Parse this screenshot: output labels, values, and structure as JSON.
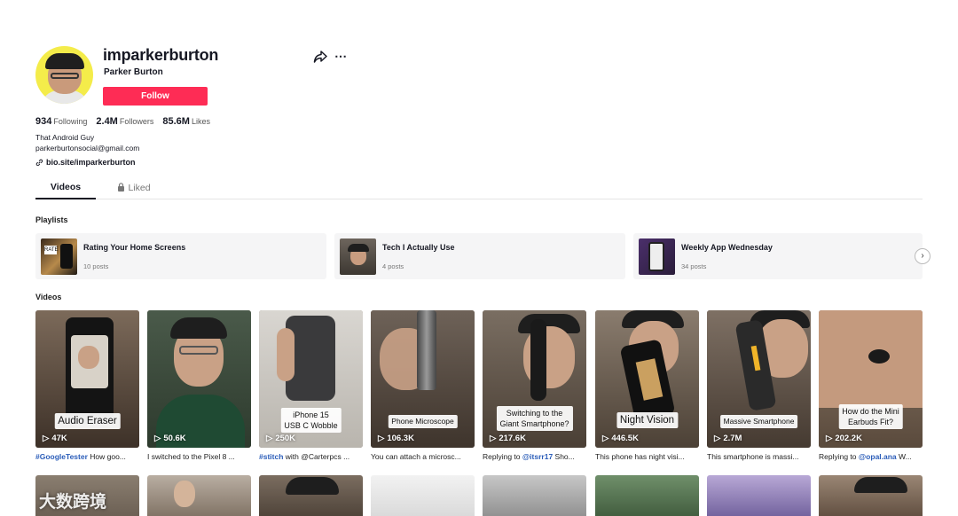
{
  "profile": {
    "username": "imparkerburton",
    "nickname": "Parker Burton",
    "follow_label": "Follow",
    "stats": [
      {
        "value": "934",
        "label": "Following"
      },
      {
        "value": "2.4M",
        "label": "Followers"
      },
      {
        "value": "85.6M",
        "label": "Likes"
      }
    ],
    "bio_line1": "That Android Guy",
    "bio_line2": "parkerburtonsocial@gmail.com",
    "link": "bio.site/imparkerburton"
  },
  "tabs": {
    "videos": "Videos",
    "liked": "Liked"
  },
  "sections": {
    "playlists": "Playlists",
    "videos": "Videos"
  },
  "playlists": [
    {
      "title": "Rating Your Home Screens",
      "count": "10 posts"
    },
    {
      "title": "Tech I Actually Use",
      "count": "4 posts"
    },
    {
      "title": "Weekly App Wednesday",
      "count": "34 posts"
    }
  ],
  "videos": [
    {
      "caption": "Audio Eraser",
      "views": "47K",
      "tag": "#GoogleTester",
      "desc": " How goo..."
    },
    {
      "caption": "",
      "views": "50.6K",
      "tag": "",
      "desc": "I switched to the Pixel 8 ..."
    },
    {
      "caption_line1": "iPhone 15",
      "caption_line2": "USB C Wobble",
      "views": "250K",
      "tag": "#stitch",
      "desc": " with @Carterpcs ..."
    },
    {
      "caption": "Phone Microscope",
      "views": "106.3K",
      "tag": "",
      "desc": "You can attach a microsc..."
    },
    {
      "caption_line1": "Switching to the",
      "caption_line2": "Giant Smartphone?",
      "views": "217.6K",
      "pre": "Replying to ",
      "tag": "@itsrr17",
      "desc": " Sho..."
    },
    {
      "caption": "Night Vision",
      "views": "446.5K",
      "tag": "",
      "desc": "This phone has night visi..."
    },
    {
      "caption": "Massive Smartphone",
      "views": "2.7M",
      "tag": "",
      "desc": "This smartphone is massi..."
    },
    {
      "caption_line1": "How do the Mini",
      "caption_line2": "Earbuds Fit?",
      "views": "202.2K",
      "pre": "Replying to ",
      "tag": "@opal.ana",
      "desc": " W..."
    }
  ],
  "watermark": "大数跨境",
  "colors": {
    "accent": "#fe2c55",
    "link": "#2b5db9"
  }
}
